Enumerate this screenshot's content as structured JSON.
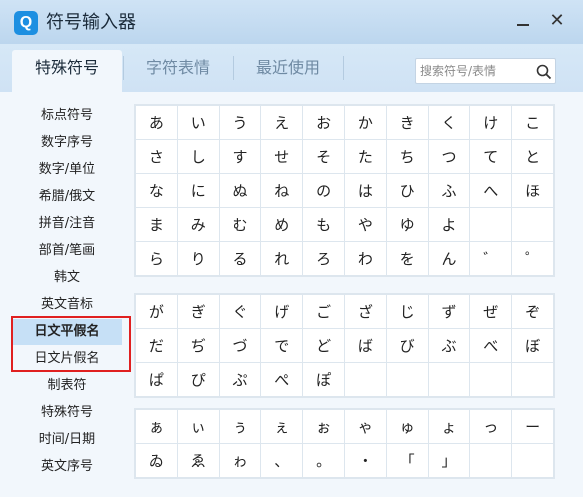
{
  "app": {
    "title": "符号输入器",
    "logo": "Q"
  },
  "window": {
    "minimize": "—",
    "close": "✕"
  },
  "tabs": [
    {
      "label": "特殊符号"
    },
    {
      "label": "字符表情"
    },
    {
      "label": "最近使用"
    }
  ],
  "search": {
    "placeholder": "搜索符号/表情"
  },
  "sidebar": {
    "items": [
      {
        "label": "标点符号"
      },
      {
        "label": "数字序号"
      },
      {
        "label": "数字/单位"
      },
      {
        "label": "希腊/俄文"
      },
      {
        "label": "拼音/注音"
      },
      {
        "label": "部首/笔画"
      },
      {
        "label": "韩文"
      },
      {
        "label": "英文音标"
      },
      {
        "label": "日文平假名"
      },
      {
        "label": "日文片假名"
      },
      {
        "label": "制表符"
      },
      {
        "label": "特殊符号"
      },
      {
        "label": "时间/日期"
      },
      {
        "label": "英文序号"
      }
    ]
  },
  "panels": [
    {
      "rows": [
        [
          "あ",
          "い",
          "う",
          "え",
          "お",
          "か",
          "き",
          "く",
          "け",
          "こ"
        ],
        [
          "さ",
          "し",
          "す",
          "せ",
          "そ",
          "た",
          "ち",
          "つ",
          "て",
          "と"
        ],
        [
          "な",
          "に",
          "ぬ",
          "ね",
          "の",
          "は",
          "ひ",
          "ふ",
          "へ",
          "ほ"
        ],
        [
          "ま",
          "み",
          "む",
          "め",
          "も",
          "や",
          "ゆ",
          "よ",
          "",
          ""
        ],
        [
          "ら",
          "り",
          "る",
          "れ",
          "ろ",
          "わ",
          "を",
          "ん",
          "゛",
          "゜"
        ]
      ]
    },
    {
      "rows": [
        [
          "が",
          "ぎ",
          "ぐ",
          "げ",
          "ご",
          "ざ",
          "じ",
          "ず",
          "ぜ",
          "ぞ"
        ],
        [
          "だ",
          "ぢ",
          "づ",
          "で",
          "ど",
          "ば",
          "び",
          "ぶ",
          "べ",
          "ぼ"
        ],
        [
          "ぱ",
          "ぴ",
          "ぷ",
          "ぺ",
          "ぽ",
          "",
          "",
          "",
          "",
          ""
        ]
      ]
    },
    {
      "rows": [
        [
          "ぁ",
          "ぃ",
          "ぅ",
          "ぇ",
          "ぉ",
          "ゃ",
          "ゅ",
          "ょ",
          "っ",
          "ー"
        ],
        [
          "ゐ",
          "ゑ",
          "ゎ",
          "、",
          "。",
          "・",
          "「",
          "」",
          "",
          ""
        ]
      ]
    }
  ]
}
